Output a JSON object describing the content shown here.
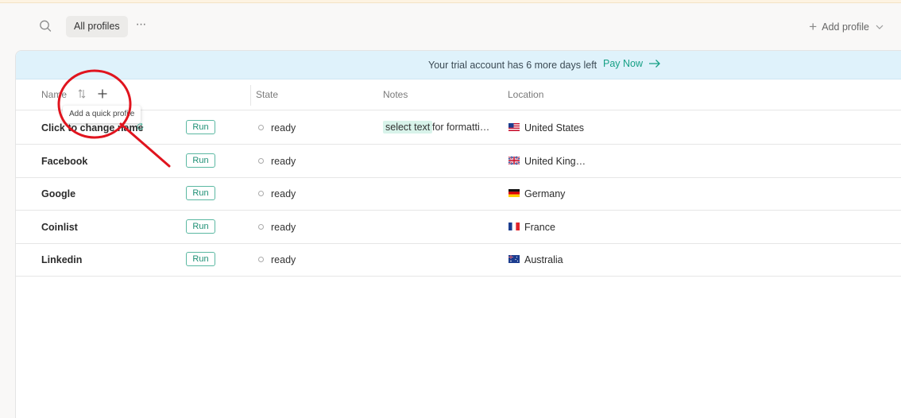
{
  "toolbar": {
    "search_icon": "search-icon",
    "tab_all": "All profiles",
    "more_icon": "more-dots-icon",
    "more_label": "···",
    "add_profile": "Add profile",
    "add_plus": "+"
  },
  "banner": {
    "text": "Your trial account has 6 more days left",
    "action": "Pay Now"
  },
  "table": {
    "headers": {
      "name": "Name",
      "state": "State",
      "notes": "Notes",
      "location": "Location"
    },
    "quick_add_tooltip": "Add a quick profile",
    "rows": [
      {
        "name": "Click to change name",
        "run": "Run",
        "state": "ready",
        "note_highlight": "select text",
        "note_rest": "for formatti…",
        "location": "United States",
        "flag": "us"
      },
      {
        "name": "Facebook",
        "run": "Run",
        "state": "ready",
        "note_highlight": "",
        "note_rest": "",
        "location": "United King…",
        "flag": "gb"
      },
      {
        "name": "Google",
        "run": "Run",
        "state": "ready",
        "note_highlight": "",
        "note_rest": "",
        "location": "Germany",
        "flag": "de"
      },
      {
        "name": "Coinlist",
        "run": "Run",
        "state": "ready",
        "note_highlight": "",
        "note_rest": "",
        "location": "France",
        "flag": "fr"
      },
      {
        "name": "Linkedin",
        "run": "Run",
        "state": "ready",
        "note_highlight": "",
        "note_rest": "",
        "location": "Australia",
        "flag": "au"
      }
    ]
  },
  "colors": {
    "accent": "#16a085",
    "banner_bg": "#dff2fb",
    "annotation": "#e0141e"
  }
}
